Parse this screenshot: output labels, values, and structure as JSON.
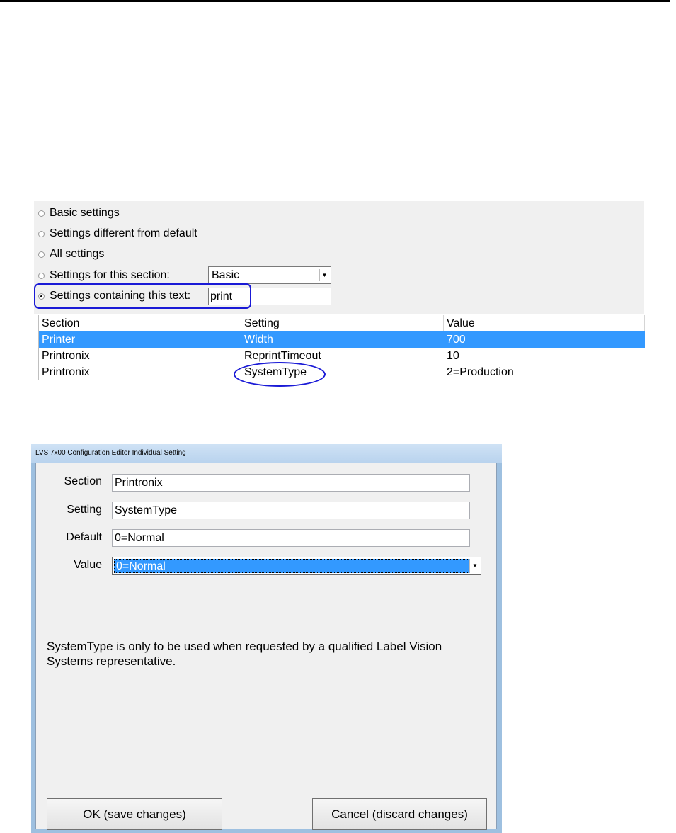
{
  "filter": {
    "options": [
      {
        "label": "Basic settings",
        "checked": false
      },
      {
        "label": "Settings different from default",
        "checked": false
      },
      {
        "label": "All settings",
        "checked": false
      },
      {
        "label": "Settings for this section:",
        "checked": false
      },
      {
        "label": "Settings containing this text:",
        "checked": true
      }
    ],
    "section_select_value": "Basic",
    "text_filter_value": "print"
  },
  "table": {
    "headers": [
      "Section",
      "Setting",
      "Value"
    ],
    "rows": [
      {
        "section": "Printer",
        "setting": "Width",
        "value": "700",
        "selected": true
      },
      {
        "section": "Printronix",
        "setting": "ReprintTimeout",
        "value": "10",
        "selected": false
      },
      {
        "section": "Printronix",
        "setting": "SystemType",
        "value": "2=Production",
        "selected": false
      }
    ]
  },
  "dialog": {
    "title": "LVS 7x00 Configuration Editor Individual Setting",
    "labels": {
      "section": "Section",
      "setting": "Setting",
      "default": "Default",
      "value": "Value"
    },
    "fields": {
      "section": "Printronix",
      "setting": "SystemType",
      "default": "0=Normal",
      "value": "0=Normal"
    },
    "help_text": "SystemType is only to be used when requested by a qualified Label Vision Systems representative.",
    "ok_label": "OK (save changes)",
    "cancel_label": "Cancel (discard changes)"
  },
  "colors": {
    "selection": "#3399ff",
    "annotation": "#1a1ad6"
  },
  "icons": {
    "dropdown": "chevron-down-icon"
  }
}
